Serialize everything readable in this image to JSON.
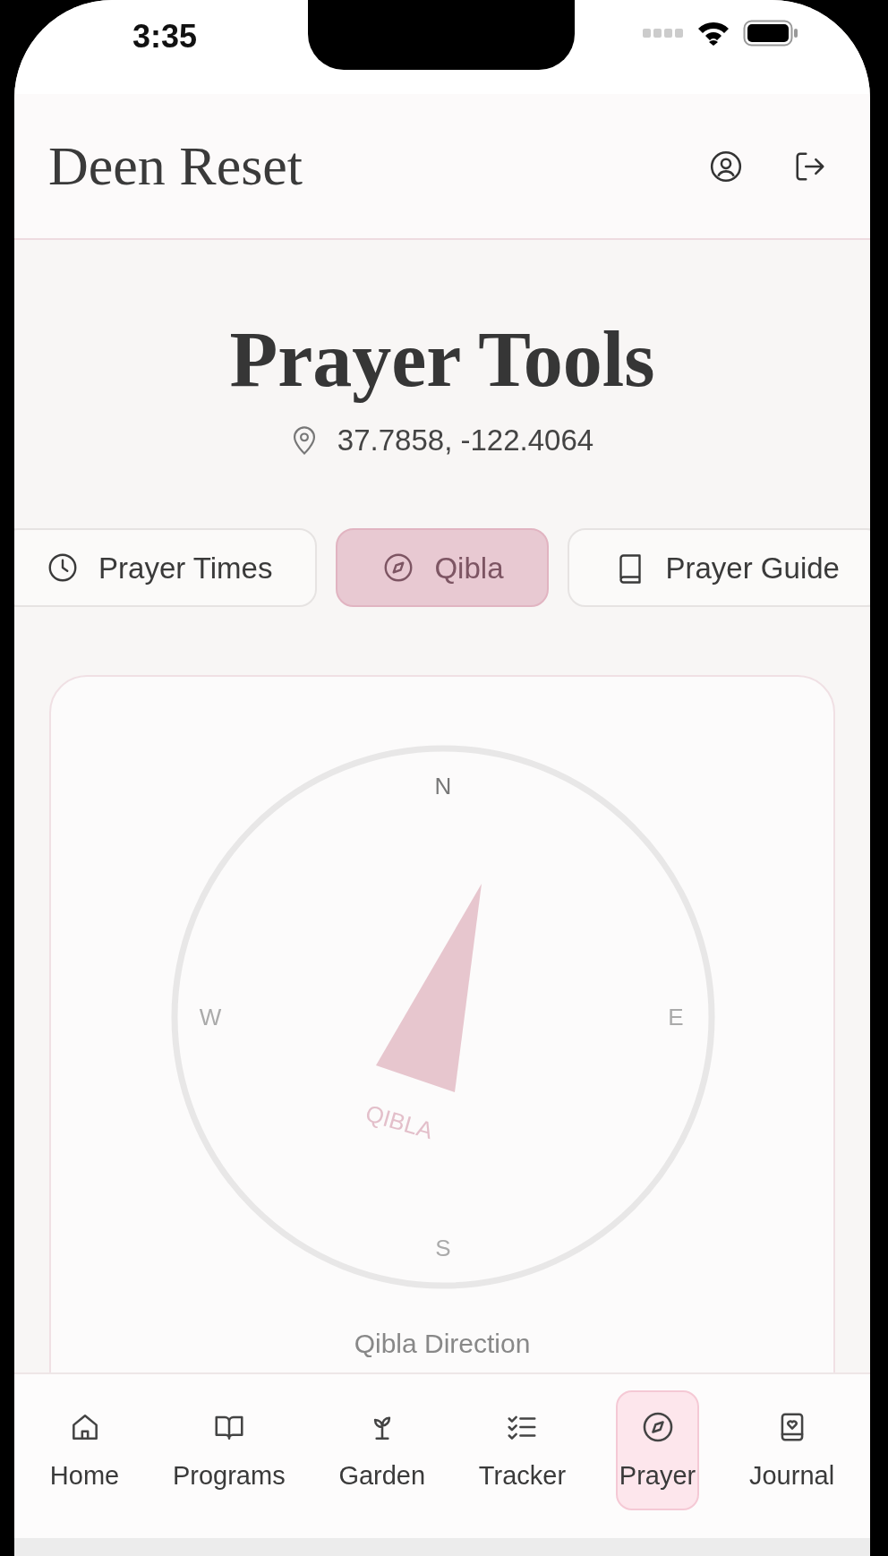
{
  "status_bar": {
    "time": "3:35"
  },
  "header": {
    "title": "Deen Reset"
  },
  "page": {
    "title": "Prayer Tools",
    "location": "37.7858, -122.4064"
  },
  "tabs": [
    {
      "label": "Prayer Times",
      "kind": "clock",
      "selected": false
    },
    {
      "label": "Qibla",
      "kind": "compass",
      "selected": true
    },
    {
      "label": "Prayer Guide",
      "kind": "book",
      "selected": false
    }
  ],
  "compass": {
    "north": "N",
    "east": "E",
    "south": "S",
    "west": "W",
    "needle_label": "QIBLA",
    "caption": "Qibla Direction"
  },
  "bottom_nav": [
    {
      "label": "Home",
      "kind": "home",
      "selected": false
    },
    {
      "label": "Programs",
      "kind": "book-open",
      "selected": false
    },
    {
      "label": "Garden",
      "kind": "sprout",
      "selected": false
    },
    {
      "label": "Tracker",
      "kind": "checklist",
      "selected": false
    },
    {
      "label": "Prayer",
      "kind": "compass",
      "selected": true
    },
    {
      "label": "Journal",
      "kind": "journal",
      "selected": false
    }
  ]
}
